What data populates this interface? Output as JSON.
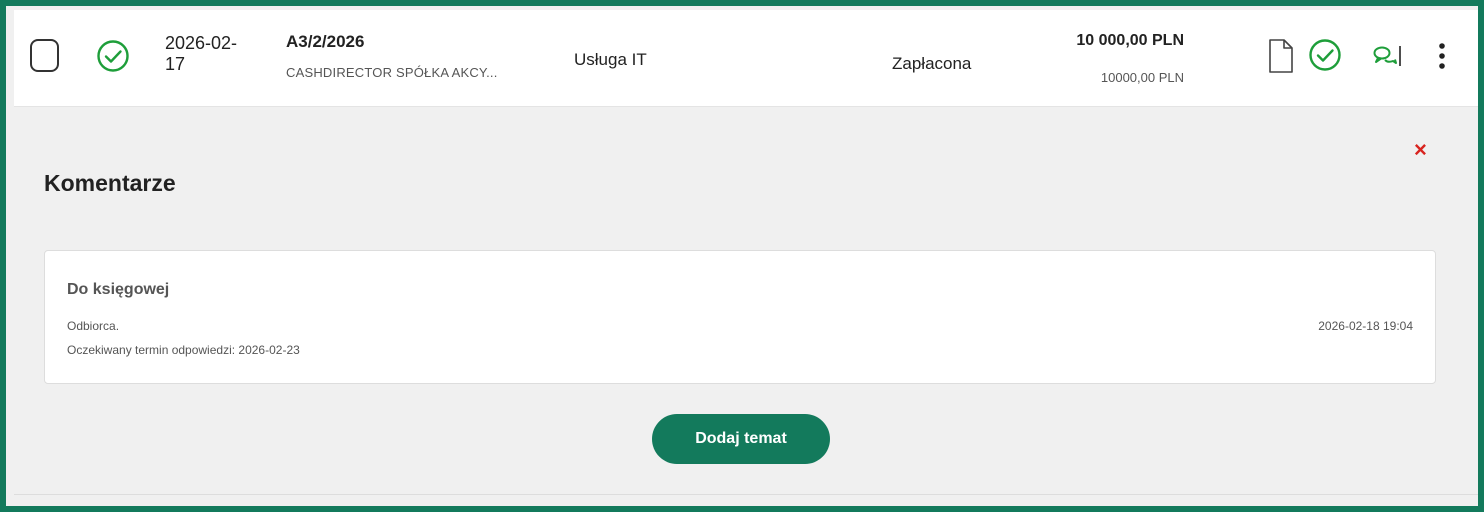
{
  "row": {
    "date": "2026-02-17",
    "invoice_number": "A3/2/2026",
    "company": "CASHDIRECTOR SPÓŁKA AKCY...",
    "category": "Usługa IT",
    "payment_status": "Zapłacona",
    "amount": "10 000,00 PLN",
    "amount_secondary": "10000,00 PLN"
  },
  "comments": {
    "title": "Komentarze",
    "close_label": "×",
    "items": [
      {
        "topic": "Do księgowej",
        "line1": "Odbiorca.",
        "line2": "Oczekiwany termin odpowiedzi: 2026-02-23",
        "timestamp": "2026-02-18 19:04"
      }
    ],
    "add_button_label": "Dodaj temat"
  },
  "colors": {
    "accent": "#137a5c",
    "status_green": "#1e9e3a",
    "close_red": "#d8241f"
  },
  "icons": [
    "checkbox",
    "check-circle-icon",
    "document-icon",
    "check-circle-icon",
    "comments-icon",
    "more-vertical-icon",
    "close-icon"
  ]
}
